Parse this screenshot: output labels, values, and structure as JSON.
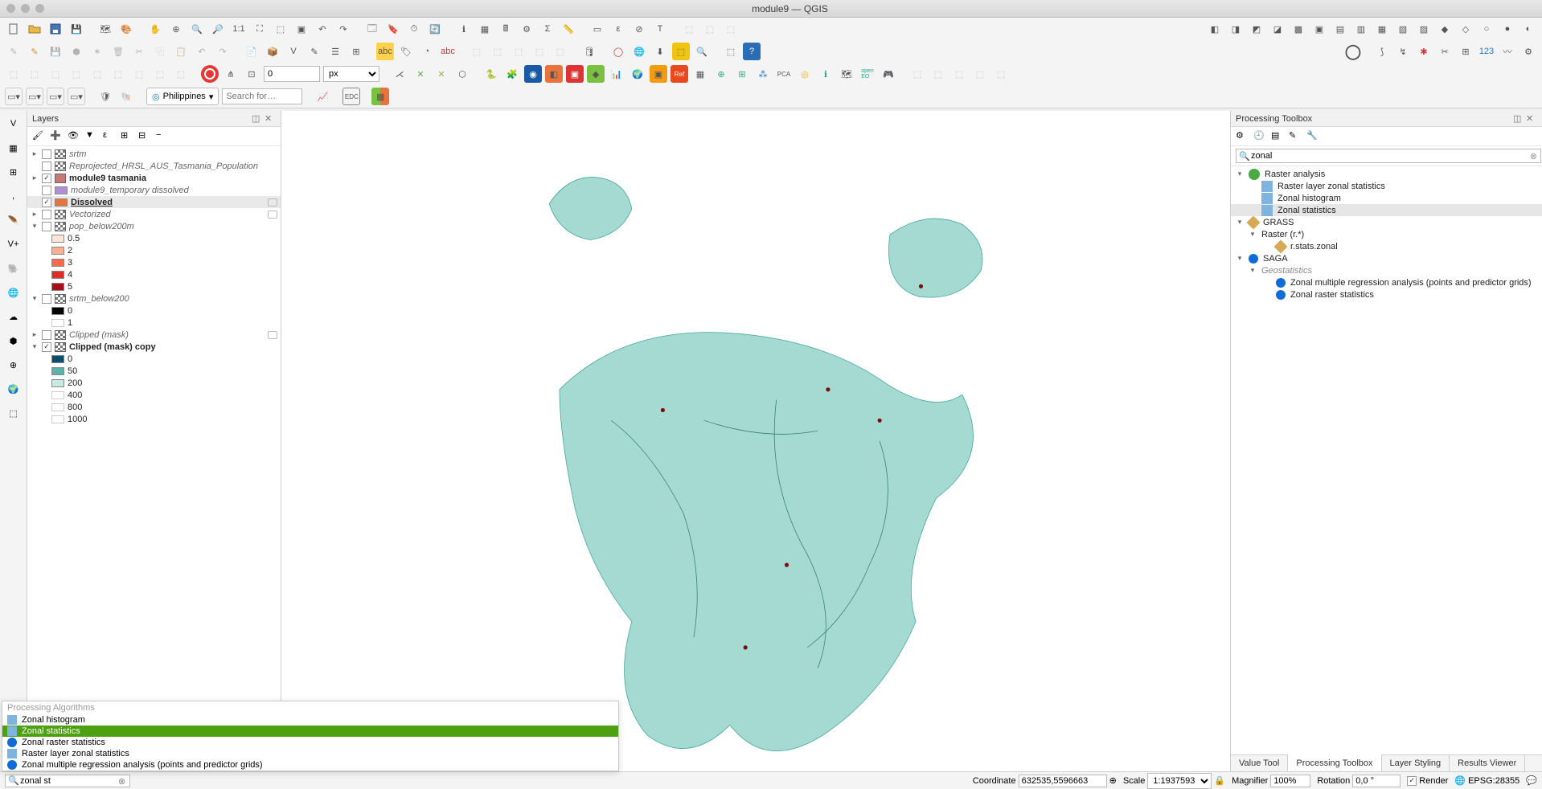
{
  "window": {
    "title": "module9 — QGIS"
  },
  "toolbar": {
    "geocoder_region": "Philippines",
    "search_placeholder": "Search for…",
    "spin_value": "0",
    "spin_unit": "px"
  },
  "panels": {
    "layers_title": "Layers",
    "toolbox_title": "Processing Toolbox"
  },
  "layers": [
    {
      "type": "group",
      "label": "srtm",
      "italic": true,
      "checked": false,
      "expand": "▸",
      "icon": "raster"
    },
    {
      "type": "group",
      "label": "Reprojected_HRSL_AUS_Tasmania_Population",
      "italic": true,
      "checked": false,
      "expand": "",
      "icon": "raster"
    },
    {
      "type": "layer",
      "label": "module9 tasmania",
      "bold": true,
      "checked": true,
      "expand": "▸",
      "icon": "vector"
    },
    {
      "type": "layer",
      "label": "module9_temporary dissolved",
      "italic": true,
      "checked": false,
      "expand": "",
      "swatch": "col-purple"
    },
    {
      "type": "layer",
      "label": "Dissolved",
      "bold": true,
      "ul": true,
      "checked": true,
      "expand": "",
      "swatch": "col-orange",
      "selected": true,
      "ind": true
    },
    {
      "type": "layer",
      "label": "Vectorized",
      "italic": true,
      "checked": false,
      "expand": "▸",
      "icon": "raster",
      "ind": true
    },
    {
      "type": "layer",
      "label": "pop_below200m",
      "italic": true,
      "checked": false,
      "expand": "▾",
      "icon": "raster"
    },
    {
      "type": "legend",
      "swatch": "col-05",
      "label": "0.5"
    },
    {
      "type": "legend",
      "swatch": "col-2",
      "label": "2"
    },
    {
      "type": "legend",
      "swatch": "col-3",
      "label": "3"
    },
    {
      "type": "legend",
      "swatch": "col-4",
      "label": "4"
    },
    {
      "type": "legend",
      "swatch": "col-5",
      "label": "5"
    },
    {
      "type": "layer",
      "label": "srtm_below200",
      "italic": true,
      "checked": false,
      "expand": "▾",
      "icon": "raster"
    },
    {
      "type": "legend",
      "swatch": "col-black",
      "label": "0"
    },
    {
      "type": "legend",
      "swatch": "",
      "label": "1"
    },
    {
      "type": "layer",
      "label": "Clipped (mask)",
      "italic": true,
      "checked": false,
      "expand": "▸",
      "icon": "raster",
      "ind": true
    },
    {
      "type": "layer",
      "label": "Clipped (mask) copy",
      "bold": true,
      "checked": true,
      "expand": "▾",
      "icon": "raster"
    },
    {
      "type": "legend",
      "swatch": "col-c0",
      "label": "0"
    },
    {
      "type": "legend",
      "swatch": "col-c50",
      "label": "50"
    },
    {
      "type": "legend",
      "swatch": "col-c200",
      "label": "200"
    },
    {
      "type": "legend",
      "swatch": "",
      "label": "400"
    },
    {
      "type": "legend",
      "swatch": "",
      "label": "800"
    },
    {
      "type": "legend",
      "swatch": "",
      "label": "1000"
    }
  ],
  "toolbox": {
    "search_value": "zonal",
    "tree": [
      {
        "lvl": 1,
        "exp": "▾",
        "label": "Raster analysis",
        "icon": "q"
      },
      {
        "lvl": 2,
        "exp": "",
        "label": "Raster layer zonal statistics",
        "icon": "gear"
      },
      {
        "lvl": 2,
        "exp": "",
        "label": "Zonal histogram",
        "icon": "gear"
      },
      {
        "lvl": 2,
        "exp": "",
        "label": "Zonal statistics",
        "icon": "gear",
        "selected": true
      },
      {
        "lvl": 1,
        "exp": "▾",
        "label": "GRASS",
        "icon": "grass"
      },
      {
        "lvl": 2,
        "exp": "▾",
        "label": "Raster (r.*)",
        "icon": ""
      },
      {
        "lvl": 3,
        "exp": "",
        "label": "r.stats.zonal",
        "icon": "grass"
      },
      {
        "lvl": 1,
        "exp": "▾",
        "label": "SAGA",
        "icon": "saga"
      },
      {
        "lvl": 2,
        "exp": "▾",
        "label": "Geostatistics",
        "italic": true,
        "icon": ""
      },
      {
        "lvl": 3,
        "exp": "",
        "label": "Zonal multiple regression analysis (points and predictor grids)",
        "icon": "saga"
      },
      {
        "lvl": 3,
        "exp": "",
        "label": "Zonal raster statistics",
        "icon": "saga"
      }
    ],
    "tabs": [
      "Value Tool",
      "Processing Toolbox",
      "Layer Styling",
      "Results Viewer"
    ],
    "active_tab": 1
  },
  "locator": {
    "header": "Processing Algorithms",
    "items": [
      {
        "label": "Zonal histogram",
        "icon": "gear"
      },
      {
        "label": "Zonal statistics",
        "icon": "gear",
        "selected": true
      },
      {
        "label": "Zonal raster statistics",
        "icon": "saga"
      },
      {
        "label": "Raster layer zonal statistics",
        "icon": "gear"
      },
      {
        "label": "Zonal multiple regression analysis (points and predictor grids)",
        "icon": "saga"
      }
    ]
  },
  "status": {
    "locator_value": "zonal st",
    "coord_label": "Coordinate",
    "coord_value": "632535,5596663",
    "scale_label": "Scale",
    "scale_value": "1:1937593",
    "magnifier_label": "Magnifier",
    "magnifier_value": "100%",
    "rotation_label": "Rotation",
    "rotation_value": "0,0 °",
    "render_label": "Render",
    "crs_label": "EPSG:28355"
  }
}
